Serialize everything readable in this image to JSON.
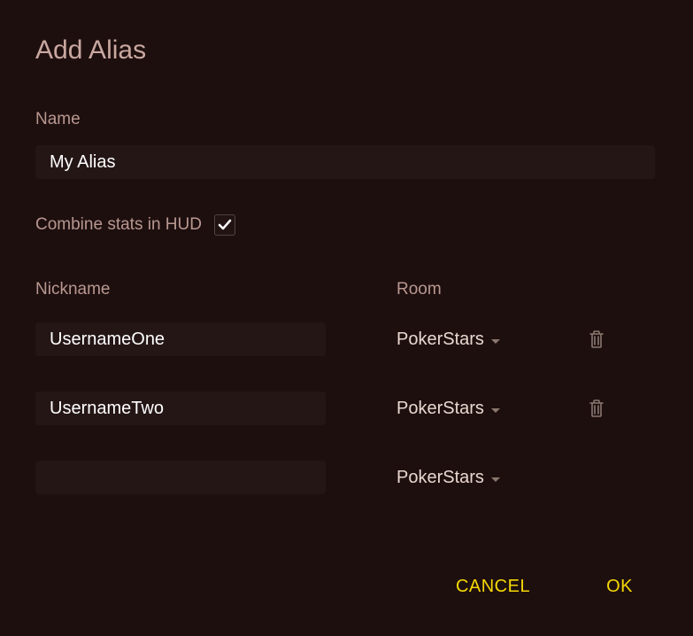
{
  "dialog": {
    "title": "Add Alias"
  },
  "name": {
    "label": "Name",
    "value": "My Alias"
  },
  "combine": {
    "label": "Combine stats in HUD",
    "checked": true
  },
  "columns": {
    "nickname": "Nickname",
    "room": "Room"
  },
  "rows": [
    {
      "nickname": "UsernameOne",
      "room": "PokerStars",
      "deletable": true
    },
    {
      "nickname": "UsernameTwo",
      "room": "PokerStars",
      "deletable": true
    },
    {
      "nickname": "",
      "room": "PokerStars",
      "deletable": false
    }
  ],
  "actions": {
    "cancel": "CANCEL",
    "ok": "OK"
  }
}
